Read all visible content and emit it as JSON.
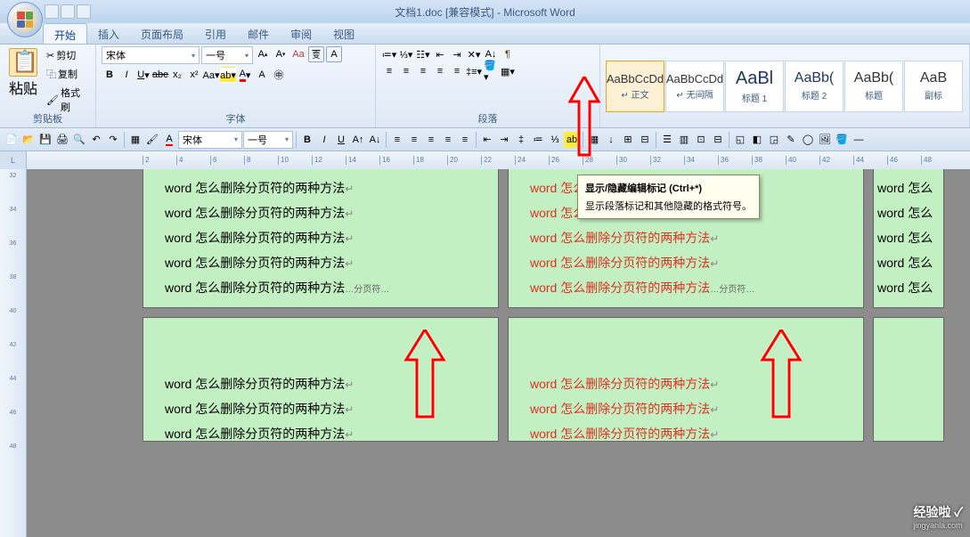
{
  "title": "文档1.doc [兼容模式] - Microsoft Word",
  "tabs": [
    "开始",
    "插入",
    "页面布局",
    "引用",
    "邮件",
    "审阅",
    "视图"
  ],
  "active_tab": 0,
  "clipboard": {
    "paste": "粘贴",
    "cut": "剪切",
    "copy": "复制",
    "format": "格式刷",
    "label": "剪贴板"
  },
  "font": {
    "name": "宋体",
    "size": "一号",
    "label": "字体"
  },
  "paragraph": {
    "label": "段落"
  },
  "styles": [
    {
      "preview": "AaBbCcDd",
      "name": "↵ 正文",
      "sel": true
    },
    {
      "preview": "AaBbCcDd",
      "name": "↵ 无间隔"
    },
    {
      "preview": "AaBl",
      "name": "标题 1"
    },
    {
      "preview": "AaBb(",
      "name": "标题 2"
    },
    {
      "preview": "AaBb(",
      "name": "标题"
    },
    {
      "preview": "AaB",
      "name": "副标"
    }
  ],
  "qat2": {
    "font": "宋体",
    "size": "一号"
  },
  "tooltip": {
    "title": "显示/隐藏编辑标记 (Ctrl+*)",
    "body": "显示段落标记和其他隐藏的格式符号。"
  },
  "doc_text": "word 怎么删除分页符的两种方法",
  "page_break": "分页符",
  "ruler_marks": [
    "2",
    "4",
    "6",
    "8",
    "10",
    "12",
    "14",
    "16",
    "18",
    "20",
    "22",
    "24",
    "26",
    "28",
    "30",
    "32",
    "34",
    "36",
    "38",
    "40",
    "42",
    "44",
    "46",
    "48"
  ],
  "vruler_marks": [
    "32",
    "34",
    "36",
    "38",
    "40",
    "42",
    "44",
    "46",
    "48"
  ],
  "watermark": {
    "main": "经验啦 ✓",
    "sub": "jingyanla.com"
  }
}
